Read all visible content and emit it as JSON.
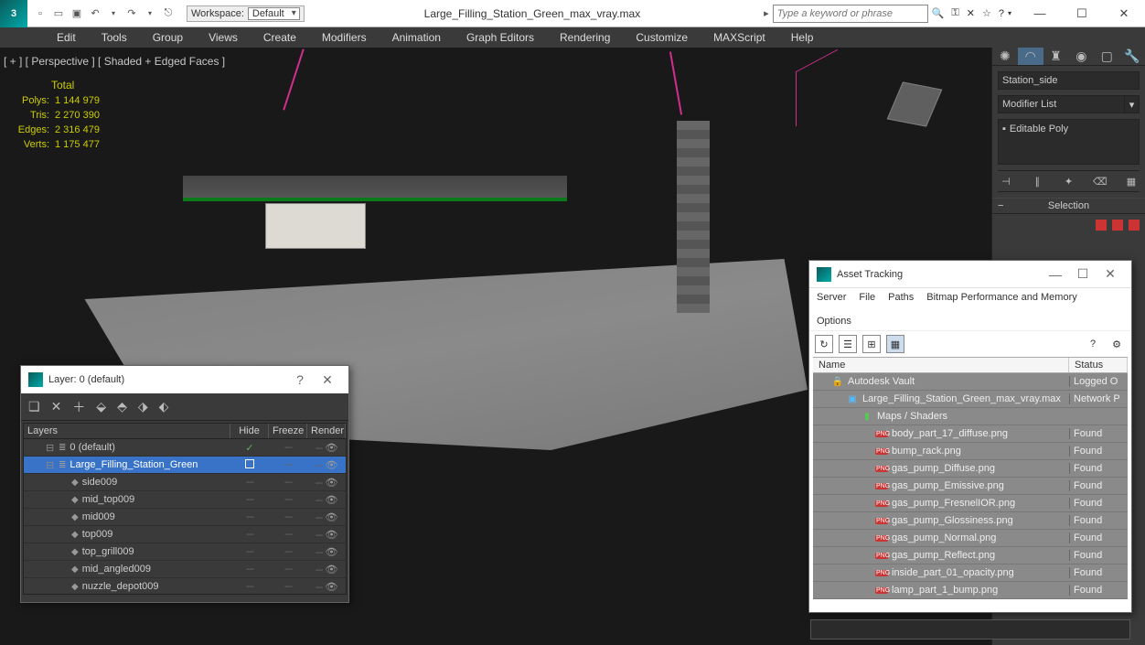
{
  "titlebar": {
    "workspace_label": "Workspace:",
    "workspace_value": "Default",
    "document": "Large_Filling_Station_Green_max_vray.max",
    "search_placeholder": "Type a keyword or phrase"
  },
  "menu": [
    "Edit",
    "Tools",
    "Group",
    "Views",
    "Create",
    "Modifiers",
    "Animation",
    "Graph Editors",
    "Rendering",
    "Customize",
    "MAXScript",
    "Help"
  ],
  "viewport": {
    "label": "[ + ] [ Perspective ] [ Shaded + Edged Faces ]",
    "stats_header": "Total",
    "stats": [
      {
        "label": "Polys:",
        "value": "1 144 979"
      },
      {
        "label": "Tris:",
        "value": "2 270 390"
      },
      {
        "label": "Edges:",
        "value": "2 316 479"
      },
      {
        "label": "Verts:",
        "value": "1 175 477"
      }
    ]
  },
  "command_panel": {
    "object_name": "Station_side",
    "modifier_list": "Modifier List",
    "stack_item": "Editable Poly",
    "rollout": "Selection"
  },
  "layer_window": {
    "title": "Layer: 0 (default)",
    "columns": [
      "Layers",
      "Hide",
      "Freeze",
      "Render"
    ],
    "rows": [
      {
        "indent": 1,
        "icon": "layer",
        "name": "0 (default)",
        "sel": false,
        "check": true
      },
      {
        "indent": 1,
        "icon": "layer",
        "name": "Large_Filling_Station_Green",
        "sel": true,
        "check": false
      },
      {
        "indent": 2,
        "icon": "obj",
        "name": "side009"
      },
      {
        "indent": 2,
        "icon": "obj",
        "name": "mid_top009"
      },
      {
        "indent": 2,
        "icon": "obj",
        "name": "mid009"
      },
      {
        "indent": 2,
        "icon": "obj",
        "name": "top009"
      },
      {
        "indent": 2,
        "icon": "obj",
        "name": "top_grill009"
      },
      {
        "indent": 2,
        "icon": "obj",
        "name": "mid_angled009"
      },
      {
        "indent": 2,
        "icon": "obj",
        "name": "nuzzle_depot009"
      }
    ]
  },
  "asset_window": {
    "title": "Asset Tracking",
    "menu": [
      "Server",
      "File",
      "Paths",
      "Bitmap Performance and Memory",
      "Options"
    ],
    "columns": [
      "Name",
      "Status"
    ],
    "rows": [
      {
        "indent": 1,
        "icon": "vault",
        "name": "Autodesk Vault",
        "status": "Logged O"
      },
      {
        "indent": 2,
        "icon": "max",
        "name": "Large_Filling_Station_Green_max_vray.max",
        "status": "Network P"
      },
      {
        "indent": 3,
        "icon": "folder",
        "name": "Maps / Shaders",
        "status": ""
      },
      {
        "indent": 4,
        "icon": "png",
        "name": "body_part_17_diffuse.png",
        "status": "Found"
      },
      {
        "indent": 4,
        "icon": "png",
        "name": "bump_rack.png",
        "status": "Found"
      },
      {
        "indent": 4,
        "icon": "png",
        "name": "gas_pump_Diffuse.png",
        "status": "Found"
      },
      {
        "indent": 4,
        "icon": "png",
        "name": "gas_pump_Emissive.png",
        "status": "Found"
      },
      {
        "indent": 4,
        "icon": "png",
        "name": "gas_pump_FresnelIOR.png",
        "status": "Found"
      },
      {
        "indent": 4,
        "icon": "png",
        "name": "gas_pump_Glossiness.png",
        "status": "Found"
      },
      {
        "indent": 4,
        "icon": "png",
        "name": "gas_pump_Normal.png",
        "status": "Found"
      },
      {
        "indent": 4,
        "icon": "png",
        "name": "gas_pump_Reflect.png",
        "status": "Found"
      },
      {
        "indent": 4,
        "icon": "png",
        "name": "inside_part_01_opacity.png",
        "status": "Found"
      },
      {
        "indent": 4,
        "icon": "png",
        "name": "lamp_part_1_bump.png",
        "status": "Found"
      }
    ]
  }
}
